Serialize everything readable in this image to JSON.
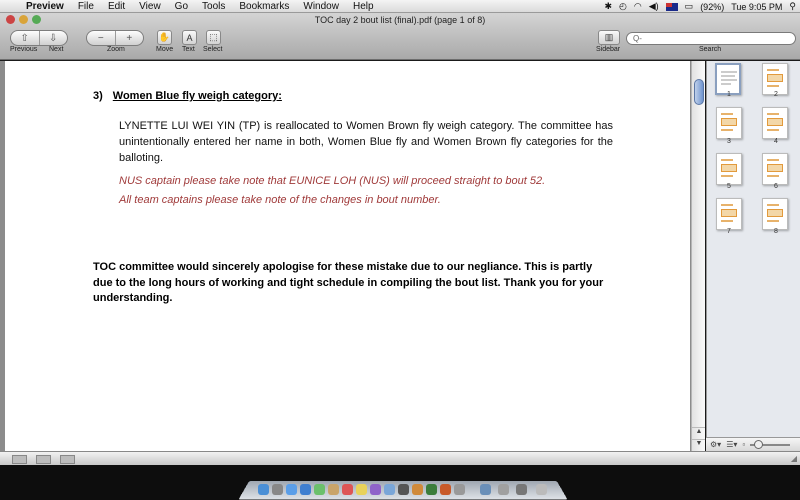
{
  "menubar": {
    "app_name": "Preview",
    "items": [
      "File",
      "Edit",
      "View",
      "Go",
      "Tools",
      "Bookmarks",
      "Window",
      "Help"
    ],
    "battery": "(92%)",
    "clock": "Tue 9:05 PM"
  },
  "window": {
    "title": "TOC day 2 bout list (final).pdf (page 1 of 8)"
  },
  "toolbar": {
    "previous_label": "Previous",
    "next_label": "Next",
    "zoom_label": "Zoom",
    "move_label": "Move",
    "text_label": "Text",
    "select_label": "Select",
    "sidebar_label": "Sidebar",
    "search_label": "Search",
    "search_placeholder": "Q-"
  },
  "document": {
    "item_number": "3)",
    "item_title": "Women Blue fly weigh category:",
    "paragraph": "LYNETTE LUI WEI YIN (TP) is reallocated to Women Brown fly weigh category. The committee has unintentionally entered her name in both, Women Blue fly and Women Brown fly categories for the balloting.",
    "note1": "NUS captain please take note that EUNICE LOH (NUS) will proceed straight to bout 52.",
    "note2": "All team captains please take note of the changes in bout number.",
    "apology": "TOC committee would sincerely apologise for these mistake due to our negliance. This is partly due to the long hours of working and tight schedule in compiling the bout list. Thank you for your understanding."
  },
  "sidebar": {
    "pages": [
      "1",
      "2",
      "3",
      "4",
      "5",
      "6",
      "7",
      "8"
    ],
    "selected_page": "1"
  },
  "colors": {
    "note_text": "#a03a3a",
    "sidebar_bg": "#e6e9ee"
  }
}
